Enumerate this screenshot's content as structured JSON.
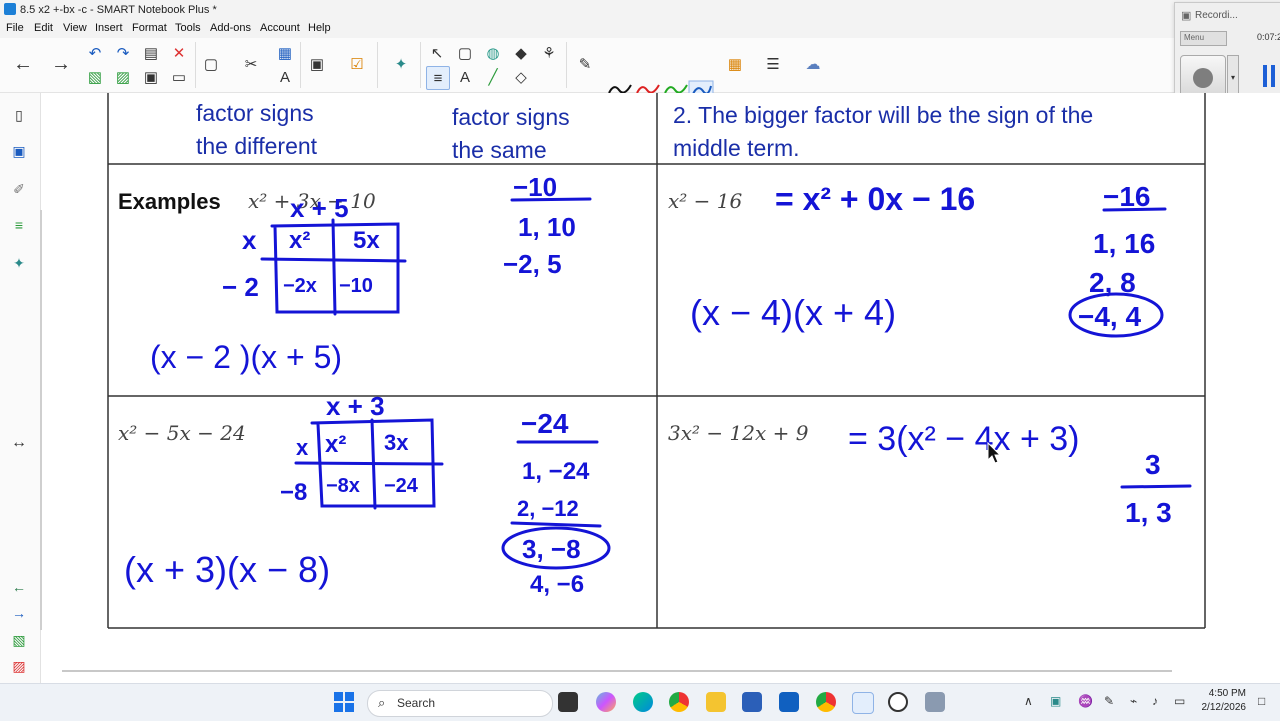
{
  "window": {
    "title": "8.5 x2 +-bx -c - SMART Notebook Plus *"
  },
  "menu": [
    "File",
    "Edit",
    "View",
    "Insert",
    "Format",
    "Tools",
    "Add-ons",
    "Account",
    "Help"
  ],
  "toolbar_icons": [
    "back-icon",
    "forward-icon",
    "undo-icon",
    "redo-icon",
    "add-page-icon",
    "delete-icon",
    "import-icon",
    "save-icon",
    "screen-capture-icon",
    "clear-icon",
    "table-icon",
    "math-icon",
    "document-camera-icon",
    "display-icon",
    "activities-icon",
    "select-icon",
    "shapes-icon",
    "fill-icon",
    "eraser-icon",
    "pen-icon",
    "text-icon",
    "line-icon",
    "properties-icon",
    "pen-tool-icon",
    "pen-color-icon",
    "colors-icon",
    "more-tools-icon",
    "cloud-icon"
  ],
  "recorder": {
    "title": "Recordi...",
    "menu": "Menu",
    "time": "0:07:2"
  },
  "slide": {
    "header": {
      "left_col": {
        "line1": "factor signs",
        "line2": "the different"
      },
      "mid_col": {
        "line1": "factor signs",
        "line2": "the same"
      },
      "right_col": {
        "line1": "2. The bigger factor will be the sign of the",
        "line2": "middle term."
      }
    },
    "cells": {
      "examples_label": "Examples",
      "expr1": "x² + 3x − 10",
      "expr2": "x² − 16",
      "expr3": "x² − 5x − 24",
      "expr4": "3x² − 12x + 9"
    },
    "handwriting": {
      "h1_top": "x  + 5",
      "h1_side_a": "x",
      "h1_side_b": "− 2",
      "h1_box": [
        "x²",
        "5x",
        "−2x",
        "−10"
      ],
      "h1_factors": [
        "−10",
        "1, 10",
        "−2, 5"
      ],
      "h1_answer": "(x − 2 )(x + 5)",
      "h2_rewrite": "=  x² + 0x − 16",
      "h2_factors": [
        "−16",
        "1, 16",
        "2, 8",
        "−4, 4"
      ],
      "h2_answer": "(x − 4)(x + 4)",
      "h3_top": "x  + 3",
      "h3_side_a": "x",
      "h3_side_b": "−8",
      "h3_box": [
        "x²",
        "3x",
        "−8x",
        "−24"
      ],
      "h3_factors": [
        "−24",
        "1, −24",
        "2, −12",
        "3, −8",
        "4, −6"
      ],
      "h3_answer": "(x + 3)(x − 8)",
      "h4_rewrite": "= 3(x² − 4x + 3)",
      "h4_factors": [
        "3",
        "1, 3"
      ]
    }
  },
  "taskbar": {
    "search_placeholder": "Search",
    "time": "4:50 PM",
    "date": "2/12/2026"
  },
  "colors": {
    "ink": "#1414d6",
    "header_text": "#1a2ea8",
    "grid": "#333333"
  }
}
